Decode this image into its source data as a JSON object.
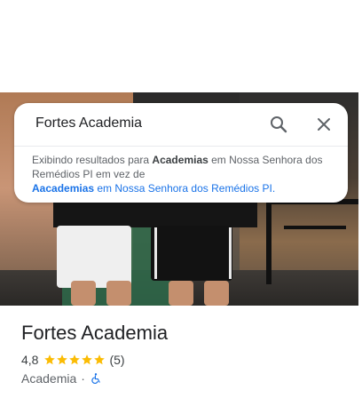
{
  "search": {
    "query": "Fortes Academia",
    "notice": {
      "prefix": "Exibindo resultados para ",
      "corrected_term": "Academias",
      "middle": " em Nossa Senhora dos Remédios PI em vez de",
      "original_term": "Aacademias",
      "suffix": " em Nossa Senhora dos Remédios PI."
    }
  },
  "place": {
    "name": "Fortes Academia",
    "rating": "4,8",
    "stars": 5,
    "review_count": "(5)",
    "category": "Academia",
    "separator": "·"
  },
  "colors": {
    "accent": "#1a73e8",
    "star": "#fbbc04",
    "text": "#202124"
  },
  "icons": [
    "search-icon",
    "close-icon",
    "star-icon",
    "wheelchair-accessible-icon"
  ]
}
